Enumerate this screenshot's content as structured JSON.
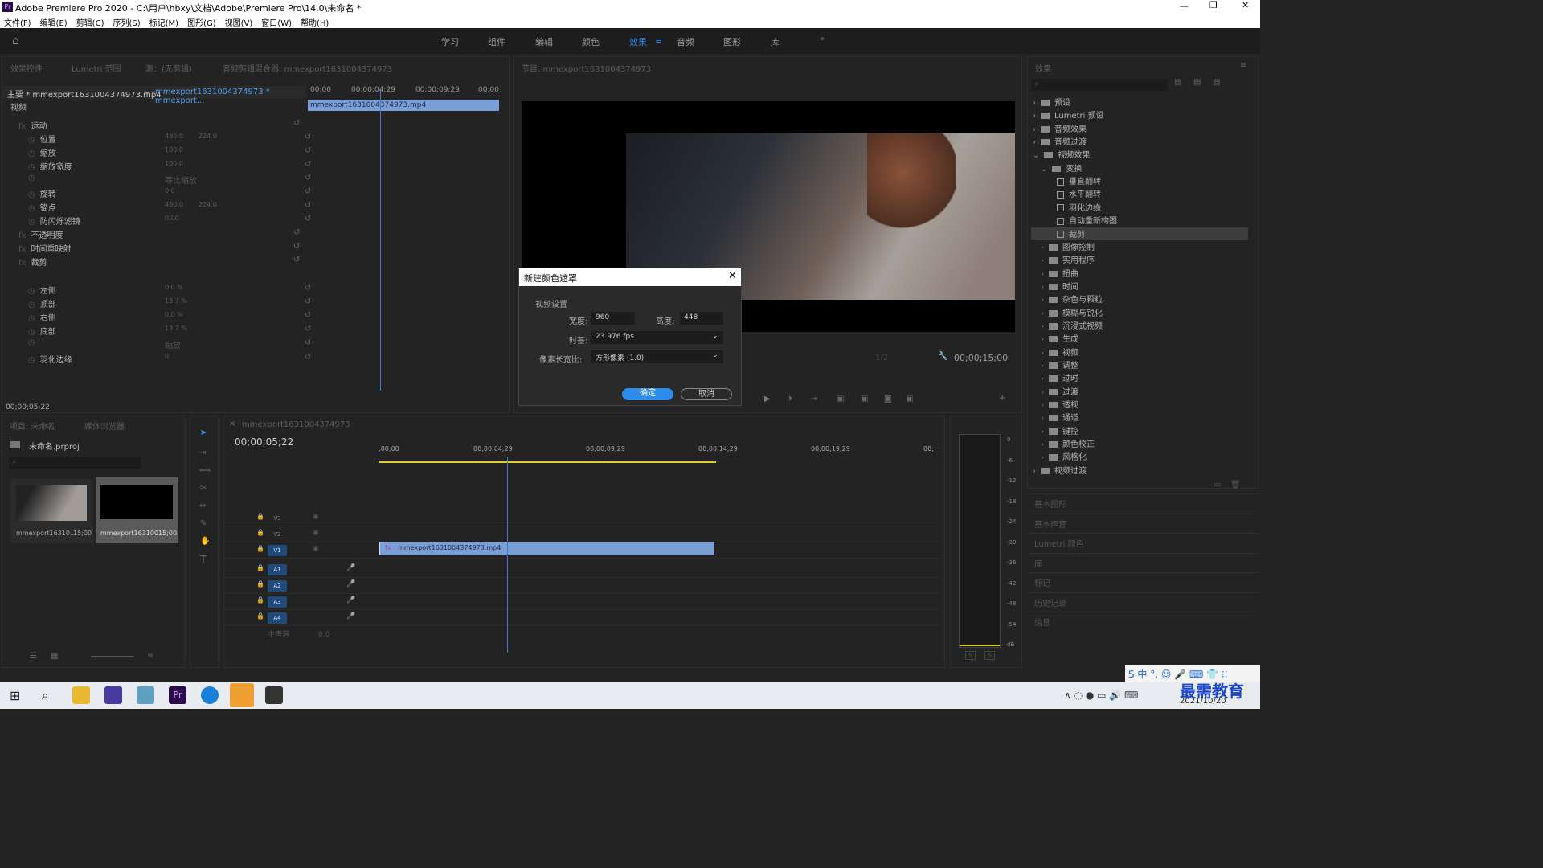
{
  "app": {
    "title": "Adobe Premiere Pro 2020 - C:\\用户\\hbxy\\文档\\Adobe\\Premiere Pro\\14.0\\未命名 *",
    "menu": [
      "文件(F)",
      "编辑(E)",
      "剪辑(C)",
      "序列(S)",
      "标记(M)",
      "图形(G)",
      "视图(V)",
      "窗口(W)",
      "帮助(H)"
    ],
    "workspaces": [
      "学习",
      "组件",
      "编辑",
      "颜色",
      "效果",
      "音频",
      "图形",
      "库"
    ],
    "active_workspace": "效果"
  },
  "effect_controls": {
    "tabs": [
      "效果控件",
      "Lumetri 范围",
      "源：(无剪辑)",
      "音频剪辑混合器: mmexport1631004374973"
    ],
    "master": "主要 * mmexport1631004374973.mp4",
    "sequence_clip": "mmexport1631004374973 * mmexport...",
    "ruler": [
      ":00;00",
      "00;00;04;29",
      "00;00;09;29",
      "00;00"
    ],
    "clip_bar": "mmexport1631004374973.mp4",
    "section_video": "视频",
    "rows": [
      {
        "label": "运动",
        "v1": "",
        "v2": ""
      },
      {
        "label": "位置",
        "v1": "480.0",
        "v2": "224.0"
      },
      {
        "label": "缩放",
        "v1": "100.0",
        "v2": ""
      },
      {
        "label": "缩放宽度",
        "v1": "100.0",
        "v2": ""
      },
      {
        "label": "等比缩放",
        "v1": "",
        "v2": ""
      },
      {
        "label": "旋转",
        "v1": "0.0",
        "v2": ""
      },
      {
        "label": "锚点",
        "v1": "480.0",
        "v2": "224.0"
      },
      {
        "label": "防闪烁滤镜",
        "v1": "0.00",
        "v2": ""
      },
      {
        "label": "不透明度",
        "v1": "",
        "v2": ""
      },
      {
        "label": "时间重映射",
        "v1": "",
        "v2": ""
      },
      {
        "label": "裁剪",
        "v1": "",
        "v2": ""
      },
      {
        "label": "左侧",
        "v1": "0.0 %",
        "v2": ""
      },
      {
        "label": "顶部",
        "v1": "13.7 %",
        "v2": ""
      },
      {
        "label": "右侧",
        "v1": "0.0 %",
        "v2": ""
      },
      {
        "label": "底部",
        "v1": "13.7 %",
        "v2": ""
      },
      {
        "label": "缩放",
        "v1": "",
        "v2": ""
      },
      {
        "label": "羽化边缘",
        "v1": "0",
        "v2": ""
      }
    ],
    "timecode": "00;00;05;22"
  },
  "program": {
    "title": "节目: mmexport1631004374973",
    "ratio": "1/2",
    "duration": "00;00;15;00"
  },
  "dialog": {
    "title": "新建颜色遮罩",
    "group": "视频设置",
    "width_label": "宽度:",
    "width": "960",
    "height_label": "高度:",
    "height": "448",
    "timebase_label": "时基:",
    "timebase": "23.976 fps",
    "par_label": "像素长宽比:",
    "par": "方形像素 (1.0)",
    "ok": "确定",
    "cancel": "取消"
  },
  "project": {
    "tabs": [
      "项目: 未命名",
      "媒体浏览器"
    ],
    "file": "未命名.prproj",
    "items": [
      {
        "name": "mmexport16310...",
        "dur": "15;00"
      },
      {
        "name": "mmexport163100...",
        "dur": "15;00"
      }
    ]
  },
  "timeline": {
    "tab": "mmexport1631004374973",
    "timecode": "00;00;05;22",
    "ruler": [
      ";00;00",
      "00;00;04;29",
      "00;00;09;29",
      "00;00;14;29",
      "00;00;19;29",
      "00;"
    ],
    "video_tracks": [
      "V3",
      "V2",
      "V1"
    ],
    "audio_tracks": [
      "A1",
      "A2",
      "A3",
      "A4"
    ],
    "master": "主声道",
    "master_val": "0.0",
    "clip": "mmexport1631004374973.mp4"
  },
  "meter": {
    "scale": [
      "0",
      "-6",
      "-12",
      "-18",
      "-24",
      "-30",
      "-36",
      "-42",
      "-48",
      "-54",
      "dB"
    ],
    "solo": [
      "S",
      "S"
    ]
  },
  "effects_panel": {
    "title": "效果",
    "tree": [
      {
        "label": "预设",
        "lvl": 0
      },
      {
        "label": "Lumetri 预设",
        "lvl": 0
      },
      {
        "label": "音频效果",
        "lvl": 0
      },
      {
        "label": "音频过渡",
        "lvl": 0
      },
      {
        "label": "视频效果",
        "lvl": 0
      },
      {
        "label": "变换",
        "lvl": 1
      },
      {
        "label": "垂直翻转",
        "lvl": 2
      },
      {
        "label": "水平翻转",
        "lvl": 2
      },
      {
        "label": "羽化边缘",
        "lvl": 2
      },
      {
        "label": "自动重新构图",
        "lvl": 2
      },
      {
        "label": "裁剪",
        "lvl": 2
      },
      {
        "label": "图像控制",
        "lvl": 1
      },
      {
        "label": "实用程序",
        "lvl": 1
      },
      {
        "label": "扭曲",
        "lvl": 1
      },
      {
        "label": "时间",
        "lvl": 1
      },
      {
        "label": "杂色与颗粒",
        "lvl": 1
      },
      {
        "label": "模糊与锐化",
        "lvl": 1
      },
      {
        "label": "沉浸式视频",
        "lvl": 1
      },
      {
        "label": "生成",
        "lvl": 1
      },
      {
        "label": "视频",
        "lvl": 1
      },
      {
        "label": "调整",
        "lvl": 1
      },
      {
        "label": "过时",
        "lvl": 1
      },
      {
        "label": "过渡",
        "lvl": 1
      },
      {
        "label": "透视",
        "lvl": 1
      },
      {
        "label": "通道",
        "lvl": 1
      },
      {
        "label": "键控",
        "lvl": 1
      },
      {
        "label": "颜色校正",
        "lvl": 1
      },
      {
        "label": "风格化",
        "lvl": 1
      },
      {
        "label": "视频过渡",
        "lvl": 0
      }
    ],
    "collapsed_panels": [
      "基本图形",
      "基本声音",
      "Lumetri 颜色",
      "库",
      "标记",
      "历史记录",
      "信息"
    ]
  },
  "taskbar": {
    "date": "2021/10/20",
    "watermark": "最需教育"
  },
  "colors": {
    "accent": "#2d8ceb",
    "playhead": "#3a7bd5",
    "clip": "#7a9fd6"
  }
}
